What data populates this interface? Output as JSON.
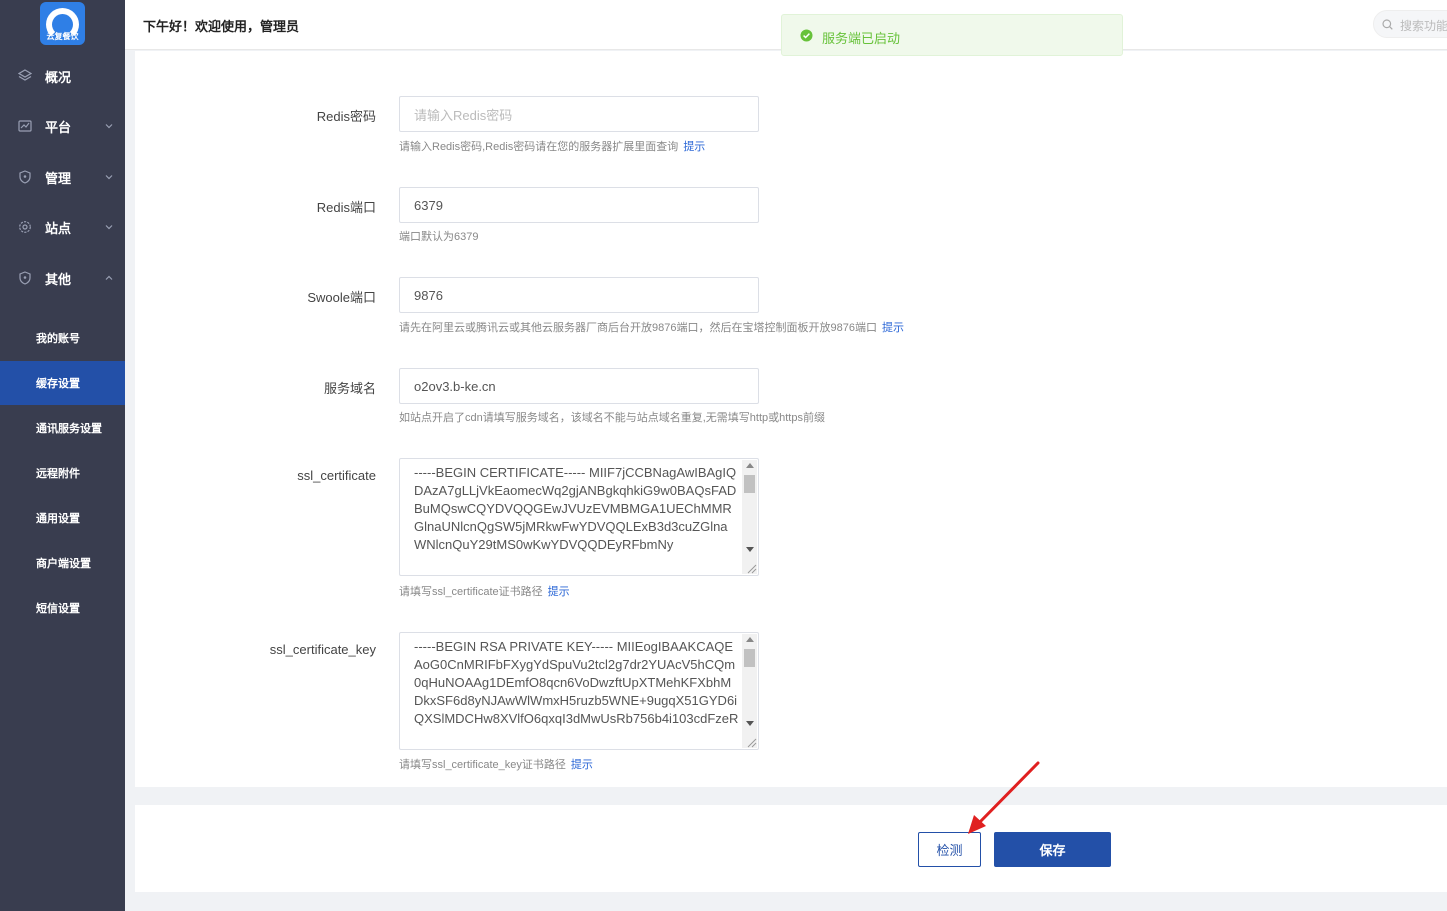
{
  "logo": {
    "text": "云复餐饮"
  },
  "header": {
    "greeting": "下午好！欢迎使用，管理员",
    "search_placeholder": "搜索功能"
  },
  "toast": {
    "message": "服务端已启动",
    "color": "#67c23a"
  },
  "sidebar": {
    "items": [
      {
        "label": "概况",
        "icon": "layers-icon"
      },
      {
        "label": "平台",
        "icon": "chart-icon"
      },
      {
        "label": "管理",
        "icon": "shield-icon"
      },
      {
        "label": "站点",
        "icon": "gear-icon"
      },
      {
        "label": "其他",
        "icon": "shield-icon"
      }
    ],
    "sub_items": [
      {
        "label": "我的账号",
        "active": false
      },
      {
        "label": "缓存设置",
        "active": true
      },
      {
        "label": "通讯服务设置",
        "active": false
      },
      {
        "label": "远程附件",
        "active": false
      },
      {
        "label": "通用设置",
        "active": false
      },
      {
        "label": "商户端设置",
        "active": false
      },
      {
        "label": "短信设置",
        "active": false
      }
    ]
  },
  "form": {
    "redis_password": {
      "label": "Redis密码",
      "placeholder": "请输入Redis密码",
      "help": "请输入Redis密码,Redis密码请在您的服务器扩展里面查询",
      "tip": "提示"
    },
    "redis_port": {
      "label": "Redis端口",
      "value": "6379",
      "help": "端口默认为6379"
    },
    "swoole_port": {
      "label": "Swoole端口",
      "value": "9876",
      "help": "请先在阿里云或腾讯云或其他云服务器厂商后台开放9876端口，然后在宝塔控制面板开放9876端口",
      "tip": "提示"
    },
    "service_domain": {
      "label": "服务域名",
      "value": "o2ov3.b-ke.cn",
      "help": "如站点开启了cdn请填写服务域名，该域名不能与站点域名重复,无需填写http或https前缀"
    },
    "ssl_certificate": {
      "label": "ssl_certificate",
      "value": "-----BEGIN CERTIFICATE----- MIIF7jCCBNagAwIBAgIQDAzA7gLLjVkEaomecWq2gjANBgkqhkiG9w0BAQsFADBuMQswCQYDVQQGEwJVUzEVMBMGA1UEChMMRGlnaUNlcnQgSW5jMRkwFwYDVQQLExB3d3cuZGlnaWNlcnQuY29tMS0wKwYDVQQDEyRFbmNy",
      "help": "请填写ssl_certificate证书路径",
      "tip": "提示"
    },
    "ssl_certificate_key": {
      "label": "ssl_certificate_key",
      "value": "-----BEGIN RSA PRIVATE KEY----- MIIEogIBAAKCAQEAoG0CnMRIFbFXygYdSpuVu2tcl2g7dr2YUAcV5hCQm0qHuNOAAg1DEmfO8qcn6VoDwzftUpXTMehKFXbhMDkxSF6d8yNJAwWlWmxH5ruzb5WNE+9ugqX51GYD6iQXSlMDCHw8XVlfO6qxqI3dMwUsRb756b4i103cdFzeR",
      "help": "请填写ssl_certificate_key证书路径",
      "tip": "提示"
    }
  },
  "buttons": {
    "check": "检测",
    "save": "保存"
  },
  "colors": {
    "sidebar_bg": "#393d4f",
    "accent": "#2350a8",
    "link": "#2a66d6",
    "annotation": "#e02020"
  }
}
